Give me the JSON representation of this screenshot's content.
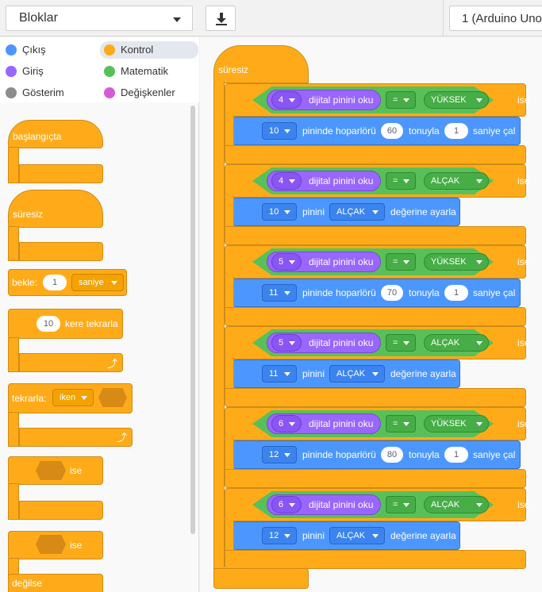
{
  "topbar": {
    "category_select": "Bloklar",
    "board_select": "1 (Arduino Uno"
  },
  "categories": [
    {
      "label": "Çıkış",
      "color": "#4c97ff"
    },
    {
      "label": "Kontrol",
      "color": "#ffab19"
    },
    {
      "label": "Giriş",
      "color": "#9966ff"
    },
    {
      "label": "Matematik",
      "color": "#59c059"
    },
    {
      "label": "Gösterim",
      "color": "#8c8c8c"
    },
    {
      "label": "Değişkenler",
      "color": "#d65cd6"
    }
  ],
  "flyout": {
    "baslangicta": "başlangıçta",
    "suresiz": "süresiz",
    "bekle": "bekle:",
    "bekle_value": "1",
    "bekle_unit": "saniye",
    "repeat_count": "10",
    "repeat_label": "kere tekrarla",
    "tekrarla": "tekrarla:",
    "iken": "iken",
    "ise": "ise",
    "ise2": "ise",
    "degilse": "değilse"
  },
  "script": {
    "forever": "süresiz",
    "sections": [
      {
        "pin": "4",
        "read_label": "dijital pinini oku",
        "op": "=",
        "level": "YÜKSEK",
        "ise": "ise",
        "action": "tone",
        "out_pin": "10",
        "a1": "pininde hoparlörü",
        "freq": "60",
        "a2": "tonuyla",
        "dur": "1",
        "a3": "saniye çal"
      },
      {
        "pin": "4",
        "read_label": "dijital pinini oku",
        "op": "=",
        "level": "ALÇAK",
        "ise": "ise",
        "action": "set",
        "out_pin": "10",
        "a1": "pinini",
        "value": "ALÇAK",
        "a3": "değerine ayarla"
      },
      {
        "pin": "5",
        "read_label": "dijital pinini oku",
        "op": "=",
        "level": "YÜKSEK",
        "ise": "ise",
        "action": "tone",
        "out_pin": "11",
        "a1": "pininde hoparlörü",
        "freq": "70",
        "a2": "tonuyla",
        "dur": "1",
        "a3": "saniye çal"
      },
      {
        "pin": "5",
        "read_label": "dijital pinini oku",
        "op": "=",
        "level": "ALÇAK",
        "ise": "ise",
        "action": "set",
        "out_pin": "11",
        "a1": "pinini",
        "value": "ALÇAK",
        "a3": "değerine ayarla"
      },
      {
        "pin": "6",
        "read_label": "dijital pinini oku",
        "op": "=",
        "level": "YÜKSEK",
        "ise": "ise",
        "action": "tone",
        "out_pin": "12",
        "a1": "pininde hoparlörü",
        "freq": "80",
        "a2": "tonuyla",
        "dur": "1",
        "a3": "saniye çal"
      },
      {
        "pin": "6",
        "read_label": "dijital pinini oku",
        "op": "=",
        "level": "ALÇAK",
        "ise": "ise",
        "action": "set",
        "out_pin": "12",
        "a1": "pinini",
        "value": "ALÇAK",
        "a3": "değerine ayarla"
      }
    ]
  }
}
